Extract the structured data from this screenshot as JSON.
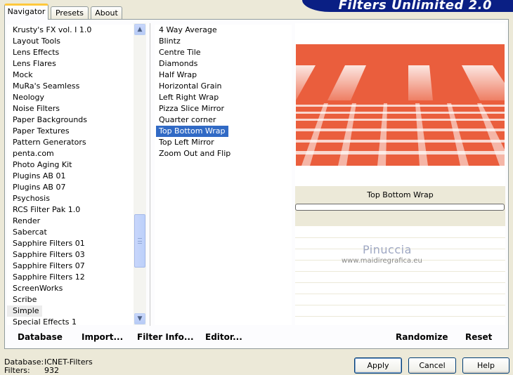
{
  "app_title": "Filters Unlimited 2.0",
  "tabs": [
    {
      "label": "Navigator",
      "active": true
    },
    {
      "label": "Presets",
      "active": false
    },
    {
      "label": "About",
      "active": false
    }
  ],
  "categories": [
    "Krusty's FX vol. I 1.0",
    "Layout Tools",
    "Lens Effects",
    "Lens Flares",
    "Mock",
    "MuRa's Seamless",
    "Neology",
    "Noise Filters",
    "Paper Backgrounds",
    "Paper Textures",
    "Pattern Generators",
    "penta.com",
    "Photo Aging Kit",
    "Plugins AB 01",
    "Plugins AB 07",
    "Psychosis",
    "RCS Filter Pak 1.0",
    "Render",
    "Sabercat",
    "Sapphire Filters 01",
    "Sapphire Filters 03",
    "Sapphire Filters 07",
    "Sapphire Filters 12",
    "ScreenWorks",
    "Scribe",
    "Simple",
    "Special Effects 1"
  ],
  "filters": [
    "4 Way Average",
    "Blintz",
    "Centre Tile",
    "Diamonds",
    "Half Wrap",
    "Horizontal Grain",
    "Left Right Wrap",
    "Pizza Slice Mirror",
    "Quarter corner",
    "Top Bottom Wrap",
    "Top Left Mirror",
    "Zoom Out and Flip"
  ],
  "selected_category": "Simple",
  "selected_filter": "Top Bottom Wrap",
  "preview": {
    "filter_name": "Top Bottom Wrap",
    "progress": 0
  },
  "watermark": {
    "name": "Pinuccia",
    "site": "www.maidiregrafica.eu"
  },
  "left_actions": {
    "database": "Database",
    "import": "Import...",
    "filter_info": "Filter Info...",
    "editor": "Editor..."
  },
  "right_actions": {
    "randomize": "Randomize",
    "reset": "Reset"
  },
  "status": {
    "database_label": "Database:",
    "database_value": "ICNET-Filters",
    "filters_label": "Filters:",
    "filters_value": "932"
  },
  "buttons": {
    "apply": "Apply",
    "cancel": "Cancel",
    "help": "Help"
  },
  "colors": {
    "selection": "#316ac5",
    "preview_base": "#ea5e3d",
    "banner": "#0a1f84"
  }
}
